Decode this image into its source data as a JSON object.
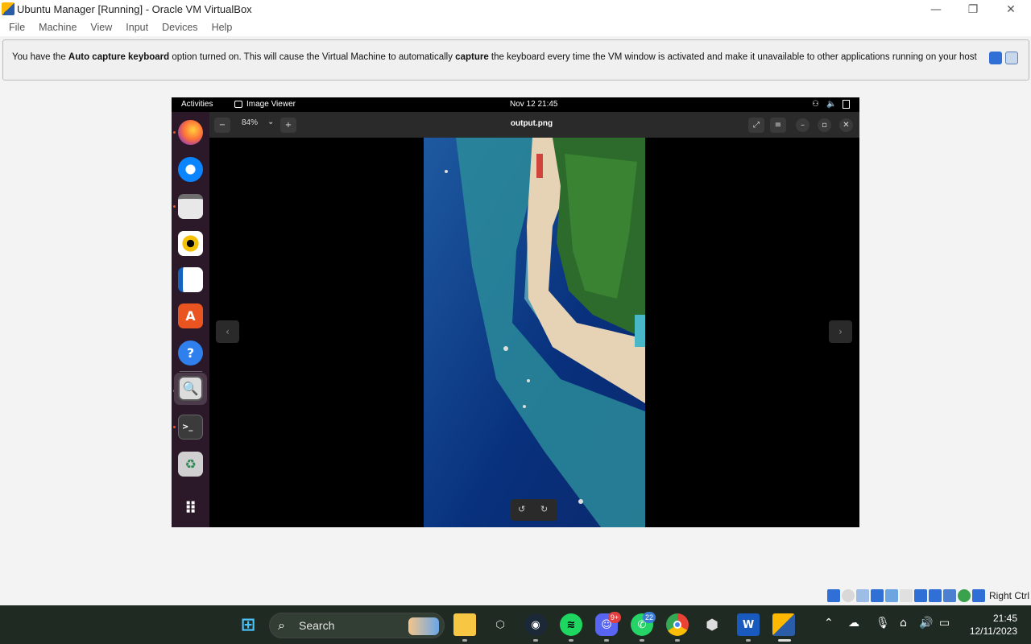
{
  "window": {
    "title": "Ubuntu Manager [Running] - Oracle VM VirtualBox",
    "minimize": "—",
    "maximize": "❐",
    "close": "✕"
  },
  "menu": [
    "File",
    "Machine",
    "View",
    "Input",
    "Devices",
    "Help"
  ],
  "notice": {
    "part1": "You have the ",
    "bold1": "Auto capture keyboard",
    "part2": " option turned on. This will cause the Virtual Machine to automatically ",
    "bold2": "capture",
    "part3": " the keyboard every time the VM window is activated and make it unavailable to other applications running on your host machine: when"
  },
  "guest": {
    "activities": "Activities",
    "app_name": "Image Viewer",
    "clock": "Nov 12  21:45",
    "viewer": {
      "zoom": "84%",
      "filename": "output.png"
    }
  },
  "vbox_status": {
    "host_key": "Right Ctrl"
  },
  "taskbar": {
    "search_label": "Search",
    "discord_badge": "9+",
    "whatsapp_badge": "22",
    "time": "21:45",
    "date": "12/11/2023"
  },
  "icons": {
    "dock": [
      "firefox-icon",
      "thunderbird-icon",
      "files-icon",
      "rhythmbox-icon",
      "writer-icon",
      "app-center-icon",
      "help-icon",
      "image-viewer-icon",
      "terminal-icon",
      "trash-icon",
      "show-apps-icon"
    ],
    "taskbar": [
      "start-icon",
      "search-icon",
      "file-explorer-icon",
      "unity-icon",
      "steam-icon",
      "spotify-icon",
      "discord-icon",
      "whatsapp-icon",
      "chrome-icon",
      "virtualbox-icon",
      "word-icon",
      "virtualbox-manager-icon"
    ]
  }
}
